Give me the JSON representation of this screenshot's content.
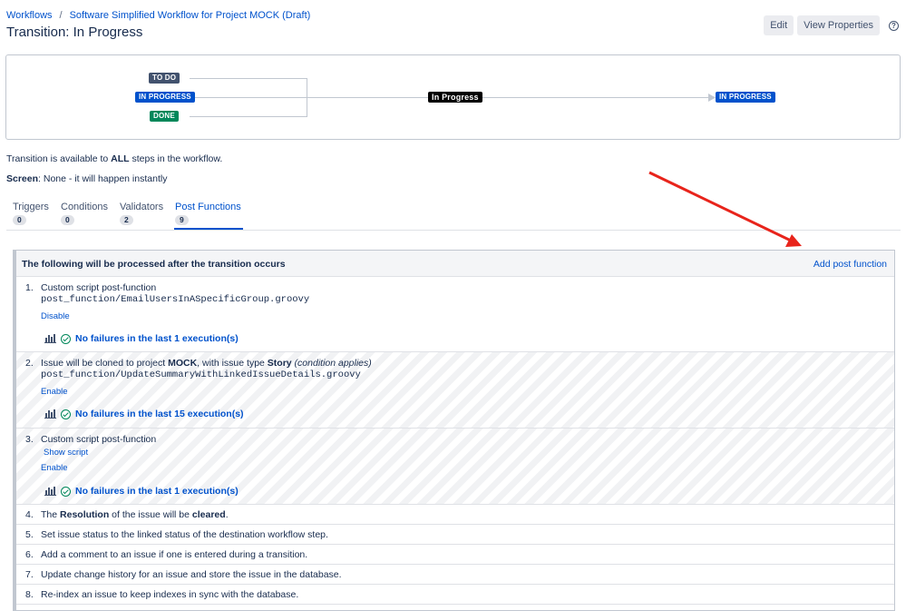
{
  "breadcrumb": {
    "workflows": "Workflows",
    "separator": "/",
    "workflow_name": "Software Simplified Workflow for Project MOCK (Draft)"
  },
  "page_title": "Transition: In Progress",
  "header_buttons": {
    "edit": "Edit",
    "view_properties": "View Properties",
    "help_icon": "?"
  },
  "diagram": {
    "source_statuses": [
      "TO DO",
      "IN PROGRESS",
      "DONE"
    ],
    "transition_name": "In Progress",
    "target_status": "IN PROGRESS"
  },
  "info": {
    "availability_pre": "Transition is available to ",
    "availability_bold": "ALL",
    "availability_post": " steps in the workflow.",
    "screen_label": "Screen",
    "screen_value": ": None - it will happen instantly"
  },
  "tabs": [
    {
      "label": "Triggers",
      "count": "0"
    },
    {
      "label": "Conditions",
      "count": "0"
    },
    {
      "label": "Validators",
      "count": "2"
    },
    {
      "label": "Post Functions",
      "count": "9"
    }
  ],
  "post_functions": {
    "header_title": "The following will be processed after the transition occurs",
    "add_link": "Add post function",
    "items": [
      {
        "num": "1.",
        "text": "Custom script post-function",
        "script": "post_function/EmailUsersInASpecificGroup.groovy",
        "action": "Disable",
        "status": "No failures in the last 1 execution(s)"
      },
      {
        "num": "2.",
        "text_1": "Issue will be cloned to project ",
        "text_2": "MOCK",
        "text_3": ", with issue type ",
        "text_4": "Story",
        "text_5": " (condition applies)",
        "script": "post_function/UpdateSummaryWithLinkedIssueDetails.groovy",
        "action": "Enable",
        "status": "No failures in the last 15 execution(s)"
      },
      {
        "num": "3.",
        "text": "Custom script post-function",
        "show_script": "Show script",
        "action": "Enable",
        "status": "No failures in the last 1 execution(s)"
      },
      {
        "num": "4.",
        "text_1": "The ",
        "text_2": "Resolution",
        "text_3": " of the issue will be ",
        "text_4": "cleared",
        "text_5": "."
      },
      {
        "num": "5.",
        "text": "Set issue status to the linked status of the destination workflow step."
      },
      {
        "num": "6.",
        "text": "Add a comment to an issue if one is entered during a transition."
      },
      {
        "num": "7.",
        "text": "Update change history for an issue and store the issue in the database."
      },
      {
        "num": "8.",
        "text": "Re-index an issue to keep indexes in sync with the database."
      }
    ]
  },
  "colors": {
    "link": "#0052cc",
    "todo": "#42526e",
    "in_progress": "#0052cc",
    "done": "#00875a",
    "annotation_arrow": "#e8241b"
  }
}
